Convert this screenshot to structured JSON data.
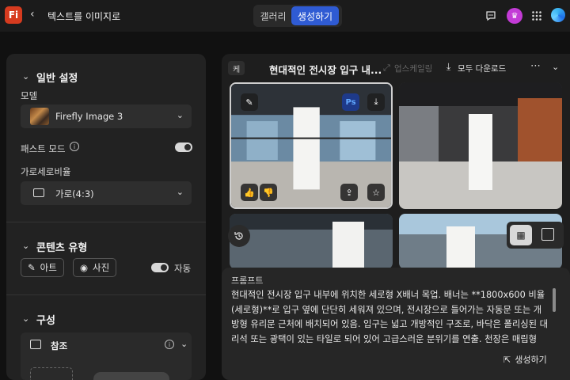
{
  "header": {
    "logo": "Fi",
    "title": "텍스트를 이미지로",
    "tabs": [
      {
        "label": "갤러리",
        "active": false
      },
      {
        "label": "생성하기",
        "active": true
      }
    ],
    "icons": [
      "back-icon",
      "chat-icon",
      "crown-icon",
      "apps-grid-icon",
      "avatar"
    ]
  },
  "left_panel": {
    "general": {
      "title": "일반 설정",
      "model_label": "모델",
      "model_value": "Firefly Image 3",
      "fast_mode_label": "패스트 모드",
      "fast_mode_on": true,
      "aspect_label": "가로세로비율",
      "aspect_value": "가로(4:3)"
    },
    "content_type": {
      "title": "콘텐츠 유형",
      "art_label": "아트",
      "photo_label": "사진",
      "auto_label": "자동",
      "auto_on": true
    },
    "composition": {
      "title": "구성",
      "reference_label": "참조"
    }
  },
  "right_panel": {
    "tag": "케",
    "title": "현대적인 전시장 입구 내...",
    "upscale_label": "업스케일링",
    "download_all_label": "모두 다운로드",
    "prompt": {
      "heading": "프롬프트",
      "text": "현대적인 전시장 입구 내부에 위치한 세로형 X배너 목업. 배너는 **1800x600 비율(세로형)**로 입구 옆에 단단히 세워져 있으며, 전시장으로 들어가는 자동문 또는 개방형 유리문 근처에 배치되어 있음. 입구는 넓고 개방적인 구조로, 바닥은 폴리싱된 대리석 또는 광택이 있는 타일로 되어 있어 고급스러운 분위기를 연출. 천장은 매립형 LED 조명 또는 산업적인 느낌의 트랙 조명으로 구성되어 있으며.",
      "generate_label": "생성하기"
    }
  },
  "colors": {
    "accent": "#2f5bd3",
    "logo": "#d63b1f",
    "crown": "#c33bd6"
  }
}
